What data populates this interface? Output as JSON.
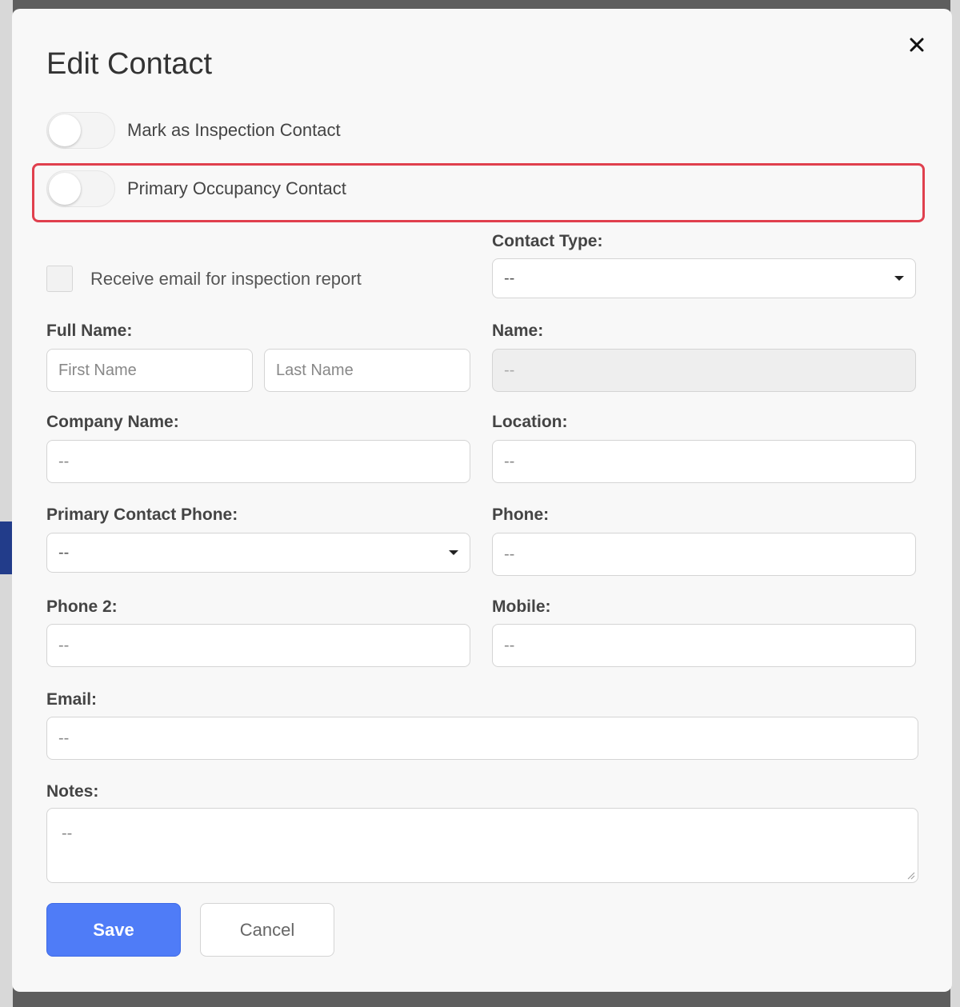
{
  "modal": {
    "title": "Edit Contact",
    "close_icon": "close-icon"
  },
  "toggles": {
    "inspection_contact": {
      "label": "Mark as Inspection Contact",
      "on": false
    },
    "primary_occupancy": {
      "label": "Primary Occupancy Contact",
      "on": false
    }
  },
  "checkbox": {
    "label": "Receive email for inspection report",
    "checked": false
  },
  "fields": {
    "contact_type": {
      "label": "Contact Type:",
      "value": "--"
    },
    "full_name": {
      "label": "Full Name:",
      "first_placeholder": "First Name",
      "last_placeholder": "Last Name"
    },
    "name": {
      "label": "Name:",
      "value": "--"
    },
    "company_name": {
      "label": "Company Name:",
      "value": "--"
    },
    "location": {
      "label": "Location:",
      "value": "--"
    },
    "primary_contact_phone": {
      "label": "Primary Contact Phone:",
      "value": "--"
    },
    "phone": {
      "label": "Phone:",
      "value": "--"
    },
    "phone2": {
      "label": "Phone 2:",
      "value": "--"
    },
    "mobile": {
      "label": "Mobile:",
      "value": "--"
    },
    "email": {
      "label": "Email:",
      "value": "--"
    },
    "notes": {
      "label": "Notes:",
      "value": "--"
    }
  },
  "buttons": {
    "save": "Save",
    "cancel": "Cancel"
  },
  "colors": {
    "accent": "#4f7cf7",
    "highlight": "#e0404e"
  }
}
